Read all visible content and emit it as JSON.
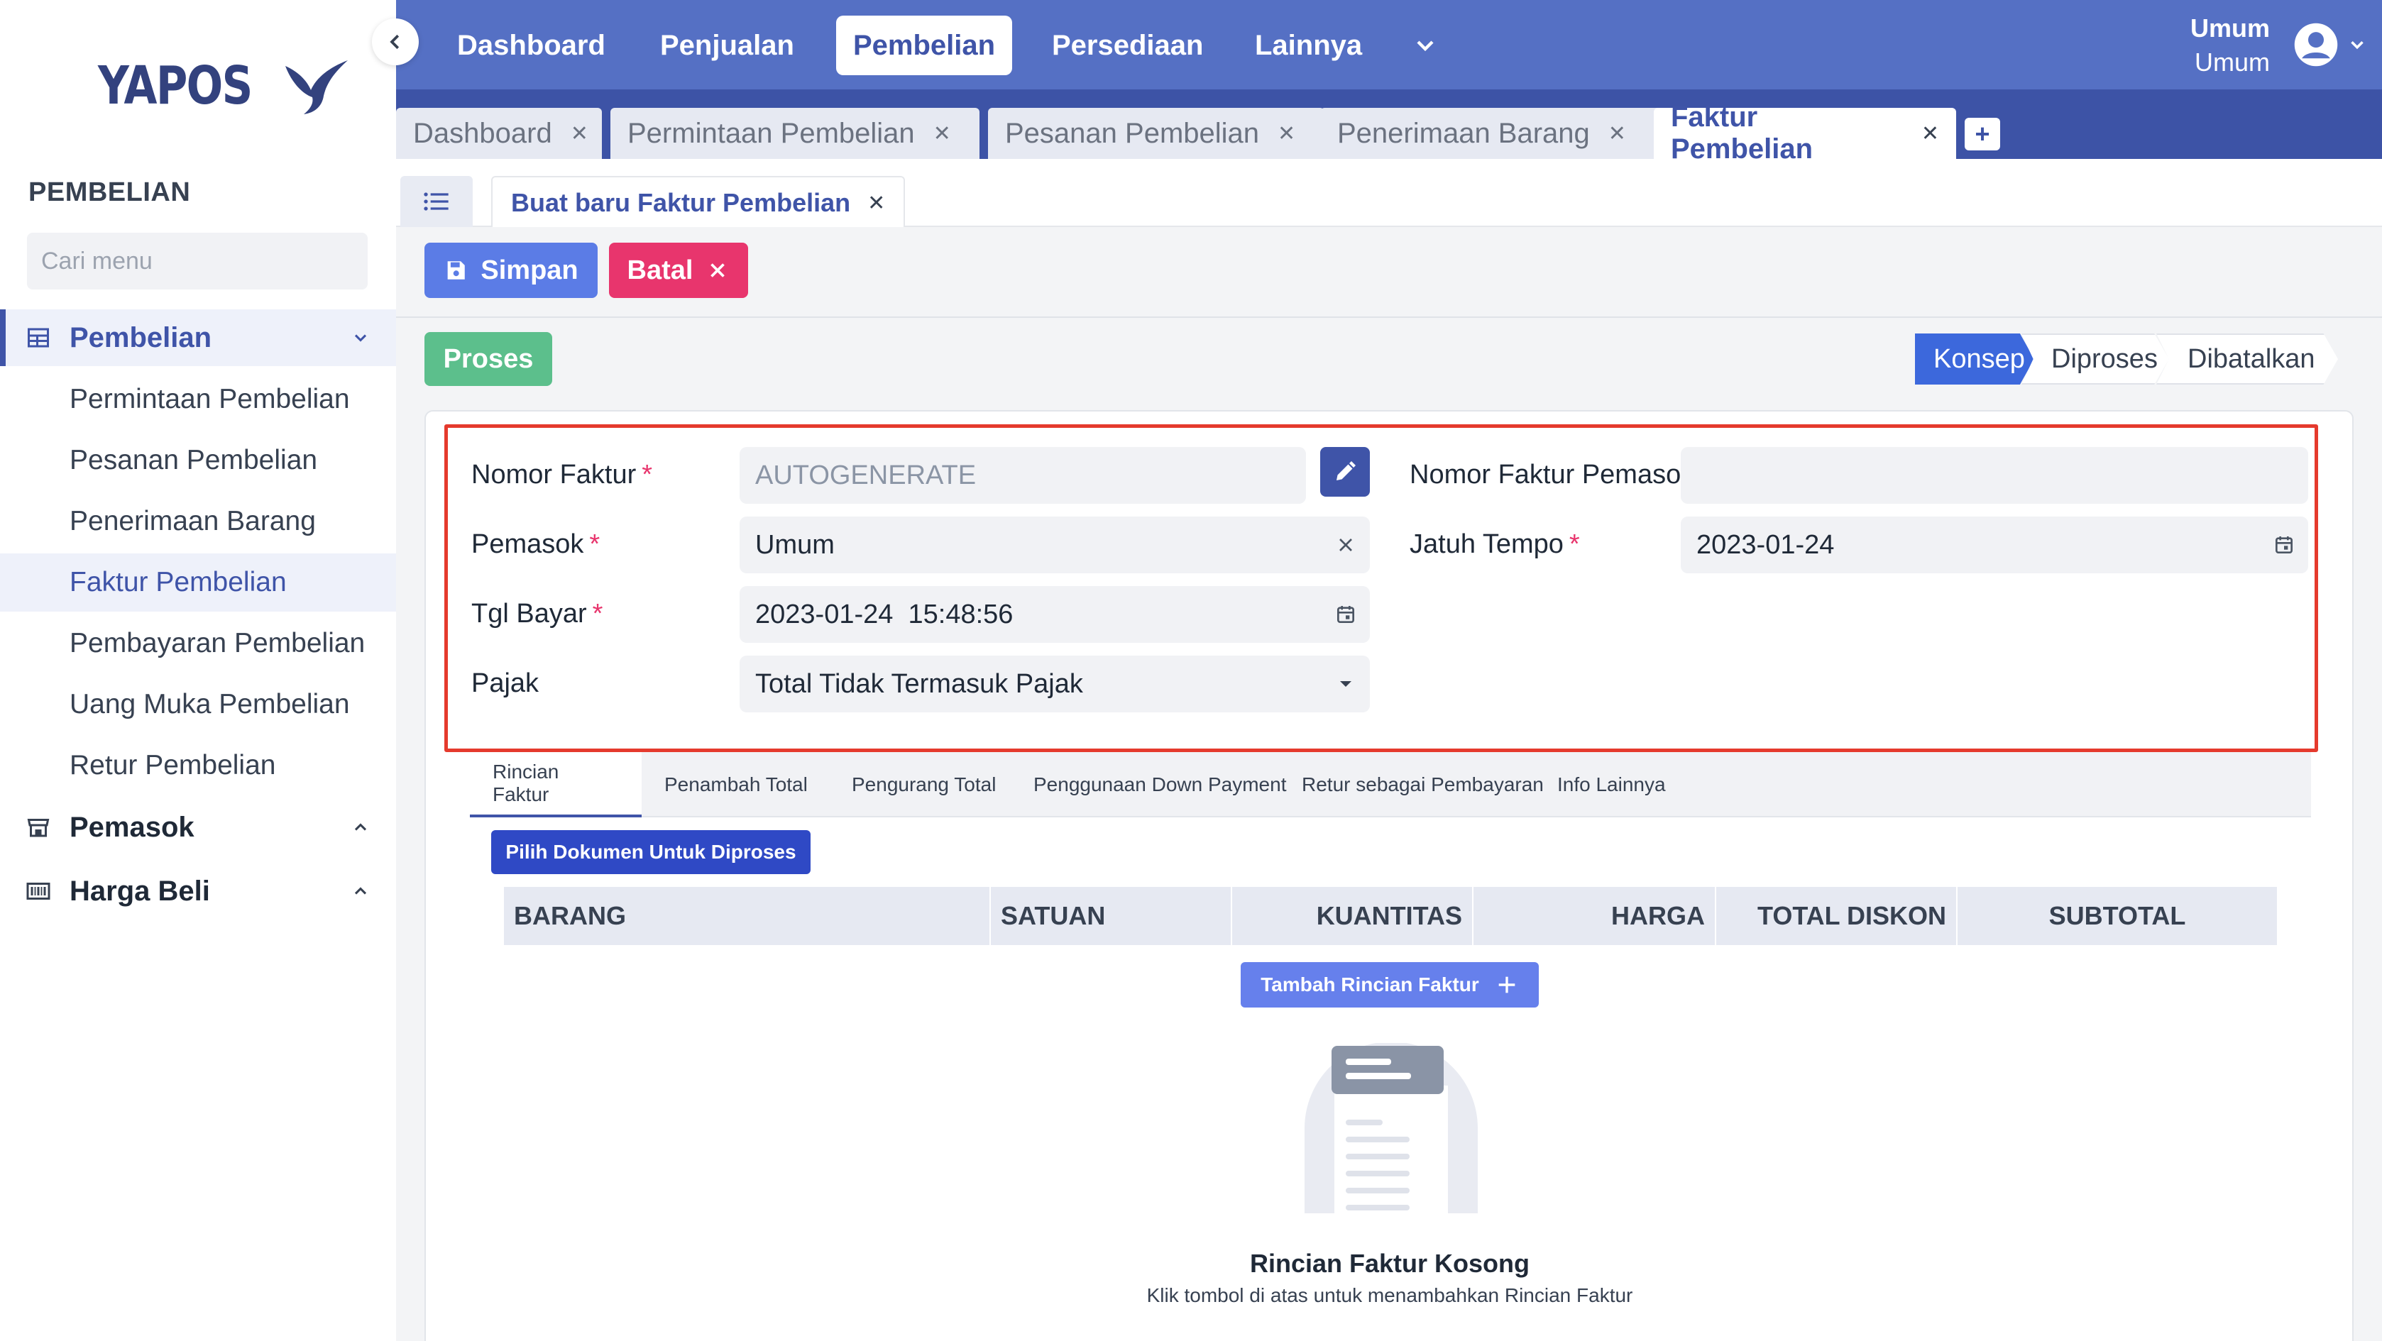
{
  "brand": {
    "name": "YAPOS"
  },
  "sidebar": {
    "section_title": "PEMBELIAN",
    "search_placeholder": "Cari menu",
    "groups": [
      {
        "label": "Pembelian",
        "icon": "table-icon",
        "expanded": true
      },
      {
        "label": "Pemasok",
        "icon": "store-icon",
        "expanded": false
      },
      {
        "label": "Harga Beli",
        "icon": "barcode-icon",
        "expanded": false
      }
    ],
    "items": [
      {
        "label": "Permintaan Pembelian"
      },
      {
        "label": "Pesanan Pembelian"
      },
      {
        "label": "Penerimaan Barang"
      },
      {
        "label": "Faktur Pembelian",
        "active": true
      },
      {
        "label": "Pembayaran Pembelian"
      },
      {
        "label": "Uang Muka Pembelian"
      },
      {
        "label": "Retur Pembelian"
      }
    ]
  },
  "topnav": {
    "items": [
      {
        "label": "Dashboard"
      },
      {
        "label": "Penjualan"
      },
      {
        "label": "Pembelian",
        "active": true
      },
      {
        "label": "Persediaan"
      },
      {
        "label": "Lainnya"
      }
    ],
    "user": {
      "line1": "Umum",
      "line2": "Umum"
    }
  },
  "window_tabs": [
    {
      "label": "Dashboard"
    },
    {
      "label": "Permintaan Pembelian"
    },
    {
      "label": "Pesanan Pembelian"
    },
    {
      "label": "Penerimaan Barang"
    },
    {
      "label": "Faktur Pembelian",
      "active": true
    }
  ],
  "sub_tab": {
    "label": "Buat baru Faktur Pembelian"
  },
  "toolbar": {
    "save_label": "Simpan",
    "cancel_label": "Batal",
    "process_label": "Proses"
  },
  "status_steps": [
    {
      "label": "Konsep",
      "active": true
    },
    {
      "label": "Diproses"
    },
    {
      "label": "Dibatalkan"
    }
  ],
  "form": {
    "nomor_faktur": {
      "label": "Nomor Faktur",
      "placeholder": "AUTOGENERATE",
      "required": true
    },
    "pemasok": {
      "label": "Pemasok",
      "value": "Umum",
      "required": true
    },
    "tgl_bayar": {
      "label": "Tgl Bayar",
      "value": "2023-01-24  15:48:56",
      "required": true
    },
    "pajak": {
      "label": "Pajak",
      "value": "Total Tidak Termasuk Pajak"
    },
    "nomor_faktur_pemasok": {
      "label": "Nomor Faktur Pemasok",
      "value": ""
    },
    "jatuh_tempo": {
      "label": "Jatuh Tempo",
      "value": "2023-01-24",
      "required": true
    },
    "required_mark": "*"
  },
  "detail_tabs": [
    {
      "label": "Rincian Faktur",
      "active": true
    },
    {
      "label": "Penambah Total"
    },
    {
      "label": "Pengurang Total"
    },
    {
      "label": "Penggunaan Down Payment"
    },
    {
      "label": "Retur sebagai Pembayaran"
    },
    {
      "label": "Info Lainnya"
    }
  ],
  "detail": {
    "pick_button": "Pilih Dokumen Untuk Diproses",
    "columns": [
      "BARANG",
      "SATUAN",
      "KUANTITAS",
      "HARGA",
      "TOTAL DISKON",
      "SUBTOTAL"
    ],
    "add_button": "Tambah Rincian Faktur",
    "empty_title": "Rincian Faktur Kosong",
    "empty_subtitle": "Klik tombol di atas untuk menambahkan Rincian Faktur"
  },
  "colors": {
    "primary": "#3f54a8",
    "nav": "#5570c4",
    "tabstrip": "#3d53a6",
    "save": "#5b7ce6",
    "cancel": "#e8356d",
    "process": "#5cbf8c",
    "step_active": "#3c68dc",
    "highlight": "#e53a2d"
  }
}
